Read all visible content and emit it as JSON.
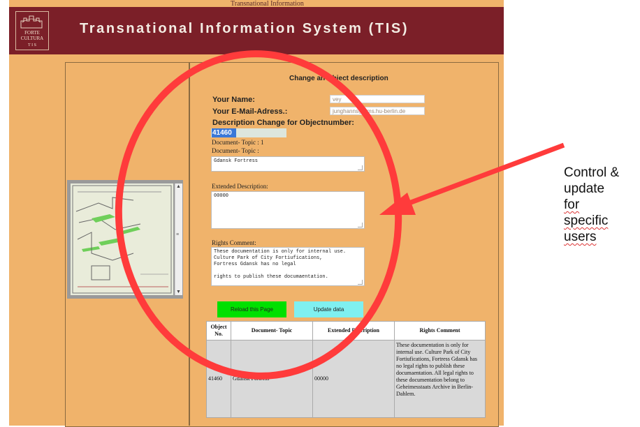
{
  "header": {
    "top_text": "Transnational Information",
    "logo_line1": "FORTE",
    "logo_line2": "CULTURA",
    "logo_line3": "T I S",
    "title": "Transnational Information System (TIS)"
  },
  "form": {
    "title": "Change an Object description",
    "name_label": "Your Name:",
    "name_value": "vey",
    "email_label": "Your E-Mail-Adress.:",
    "email_value": "junghanns@cms.hu-berlin.de",
    "desc_change_label": "Description Change for Objectnumber:",
    "object_number": "41460",
    "doc_topic_line1": "Document- Topic : 1",
    "doc_topic_line2": "Document- Topic :",
    "doc_topic_value": "Gdansk Fortress",
    "ext_desc_label": "Extended Description:",
    "ext_desc_value": "00000",
    "rights_label": "Rights Comment:",
    "rights_value": "These documentation is only for internal use.\nCulture Park of City Fortiufications,\nFortress Gdansk has no legal\n\nrights to publish these documaentation.",
    "reload_button": "Reload this Page",
    "update_button": "Update data"
  },
  "table": {
    "headers": [
      "Object No.",
      "Document- Topic",
      "Extended Description",
      "Rights Comment"
    ],
    "rows": [
      {
        "object_no": "41460",
        "topic": "Gdansk Fortress",
        "ext": "00000",
        "rights": "These documentation is only for internal use. Culture Park of City Fortiufications, Fortress Gdansk has no legal rights to publish these documaentation. All legal rights to these documentation belong to Geheimesstaats Archive in Berlin-Dahlem."
      }
    ]
  },
  "annotation": {
    "lines": [
      "Control &",
      "update",
      "for",
      "specific",
      "users"
    ]
  },
  "colors": {
    "header_bg": "#7b1f28",
    "page_bg": "#f0b36b",
    "reload_btn": "#00e000",
    "update_btn": "#7ff0f0",
    "circle": "#ff3b3b"
  }
}
